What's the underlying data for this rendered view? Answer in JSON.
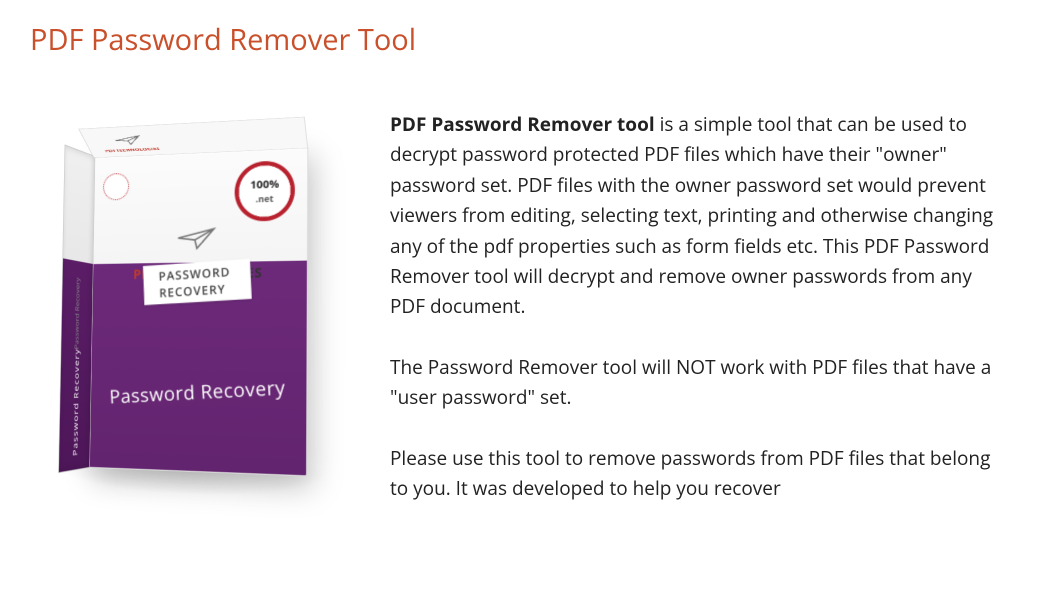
{
  "title": "PDF Password Remover Tool",
  "product_box": {
    "badge_percent": "100%",
    "badge_sub": ".net",
    "brand_pdf": "PDF",
    "brand_tech": "TECHNOLOGIES",
    "strip_label": "PASSWORD RECOVERY",
    "main_label": "Password Recovery",
    "side_text": "Password Recovery",
    "side_text2": "Password Recovery"
  },
  "description": {
    "lead_bold": "PDF Password Remover tool",
    "para1_rest": " is a simple tool that can be used to decrypt password protected PDF files which have their \"owner\" password set. PDF files with the owner password set would prevent viewers from editing, selecting text, printing and otherwise changing any of the pdf properties such as form fields etc. This PDF Password Remover tool will decrypt and remove owner passwords from any PDF document.",
    "para2": "The Password Remover tool will NOT work with PDF files that have a \"user password\" set.",
    "para3": "Please use this tool to remove passwords from PDF files that belong to you. It was developed to help you recover"
  }
}
